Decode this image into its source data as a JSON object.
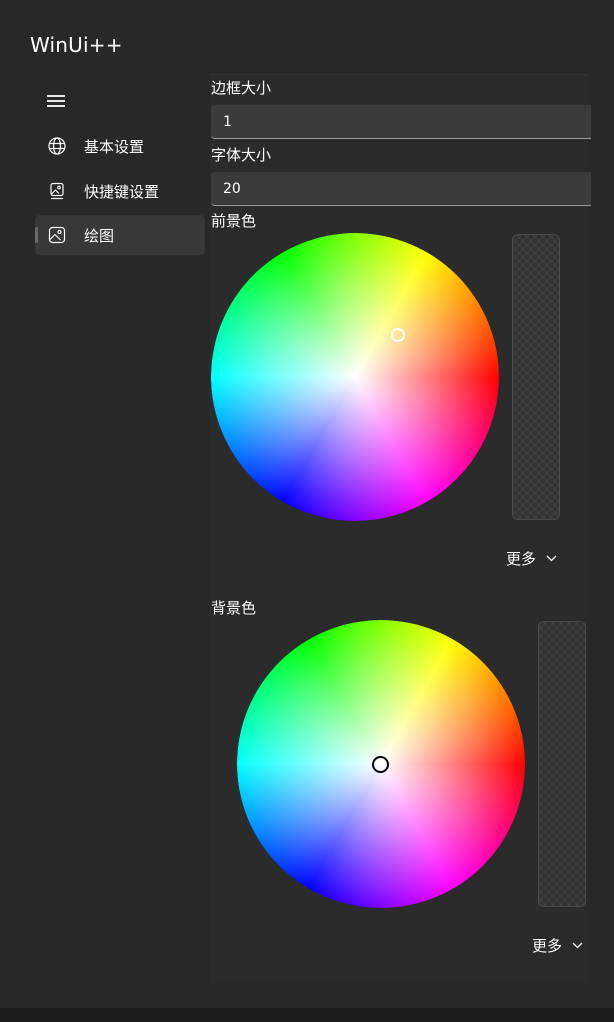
{
  "app": {
    "title": "WinUi++"
  },
  "nav": {
    "items": [
      {
        "label": "基本设置",
        "icon": "globe-icon"
      },
      {
        "label": "快捷键设置",
        "icon": "image-badge-icon"
      },
      {
        "label": "绘图",
        "icon": "image-icon",
        "selected": true
      }
    ]
  },
  "settings": {
    "border_size": {
      "label": "边框大小",
      "value": "1"
    },
    "font_size": {
      "label": "字体大小",
      "value": "20"
    },
    "foreground": {
      "label": "前景色",
      "more_label": "更多",
      "thumb_color": "#ffffff"
    },
    "background": {
      "label": "背景色",
      "more_label": "更多",
      "thumb_color": "#000000"
    }
  },
  "colors": {
    "window_bg": "#282828",
    "content_bg": "#2b2b2b",
    "selected_nav_bg": "#383838"
  }
}
